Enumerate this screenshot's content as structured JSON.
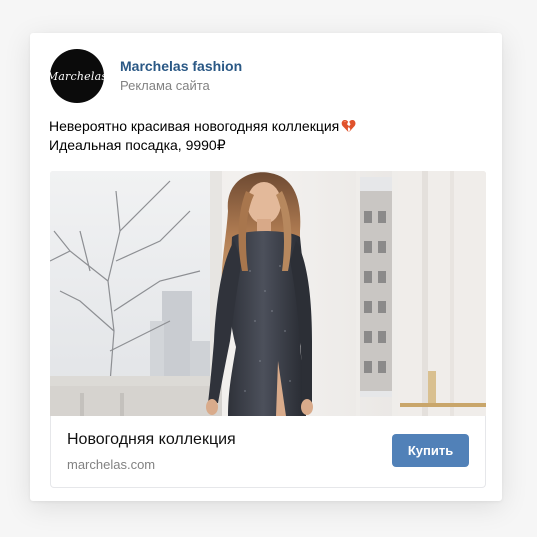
{
  "advertiser": {
    "logo_text": "Marchelas",
    "name": "Marchelas fashion",
    "label": "Реклама сайта"
  },
  "post": {
    "line1": "Невероятно красивая  новогодняя коллекция",
    "line1_emoji": "broken-heart-icon",
    "line2": "Идеальная посадка, 9990₽"
  },
  "image": {
    "subject": "fashion-photo-woman-sequin-dress"
  },
  "link_card": {
    "title": "Новогодняя коллекция",
    "domain": "marchelas.com",
    "button_label": "Купить",
    "button_color": "#5181b8"
  },
  "colors": {
    "brand_link": "#2a5885",
    "secondary_text": "#828282"
  }
}
